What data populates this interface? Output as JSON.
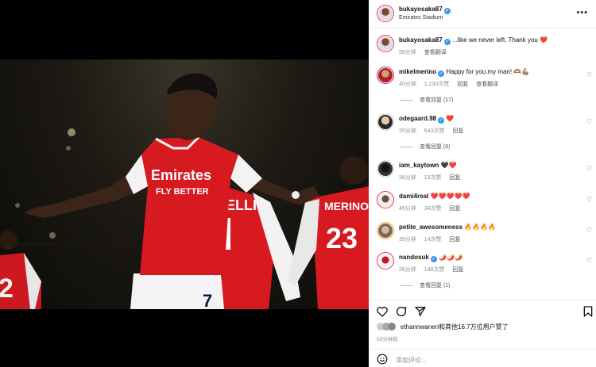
{
  "header": {
    "username": "bukayosaka87",
    "location": "Emirates Stadium",
    "more_icon": "more-icon"
  },
  "caption": {
    "username": "bukayosaka87",
    "text": "...like we never left. Thank you",
    "emoji": "❤️",
    "time": "59分钟",
    "translate": "查看翻译"
  },
  "comments": [
    {
      "username": "mikelmerino",
      "verified": true,
      "text": "Happy for you my man!",
      "emoji": "🫶🏽💪🏽",
      "time": "40分钟",
      "likes": "1,230次赞",
      "reply": "回复",
      "translate": "查看翻译",
      "replies": "查看回复 (17)"
    },
    {
      "username": "odegaard.98",
      "verified": true,
      "text": "",
      "emoji": "❤️",
      "time": "20分钟",
      "likes": "643次赞",
      "reply": "回复",
      "replies": "查看回复 (8)"
    },
    {
      "username": "iam_kaytown",
      "verified": false,
      "text": "",
      "emoji": "🖤❤️",
      "time": "36分钟",
      "likes": "13次赞",
      "reply": "回复"
    },
    {
      "username": "dami4real",
      "verified": false,
      "text": "",
      "emoji": "❤️❤️❤️❤️❤️",
      "time": "45分钟",
      "likes": "34次赞",
      "reply": "回复"
    },
    {
      "username": "petite_awesomeness",
      "verified": false,
      "text": "",
      "emoji": "🔥🔥🔥🔥",
      "time": "39分钟",
      "likes": "14次赞",
      "reply": "回复"
    },
    {
      "username": "nandosuk",
      "verified": true,
      "text": "",
      "emoji": "🌶️🌶️🌶️",
      "time": "26分钟",
      "likes": "148次赞",
      "reply": "回复",
      "replies": "查看回复 (1)"
    }
  ],
  "footer": {
    "liked_by": "ethannwaneri和其他16.7万位用户赞了",
    "time": "59分钟前",
    "add_comment_placeholder": "添加评论..."
  },
  "photo": {
    "shirt_sponsor_line1": "Emirates",
    "shirt_sponsor_line2": "FLY BETTER",
    "player_number": "7",
    "right_player_name": "MERINO",
    "right_player_number": "23",
    "left_player_number": "2",
    "mid_player_name": "ELLI"
  },
  "colors": {
    "arsenal_red": "#d71920",
    "verified_blue": "#3897f0",
    "heart_red": "#ed4956"
  }
}
